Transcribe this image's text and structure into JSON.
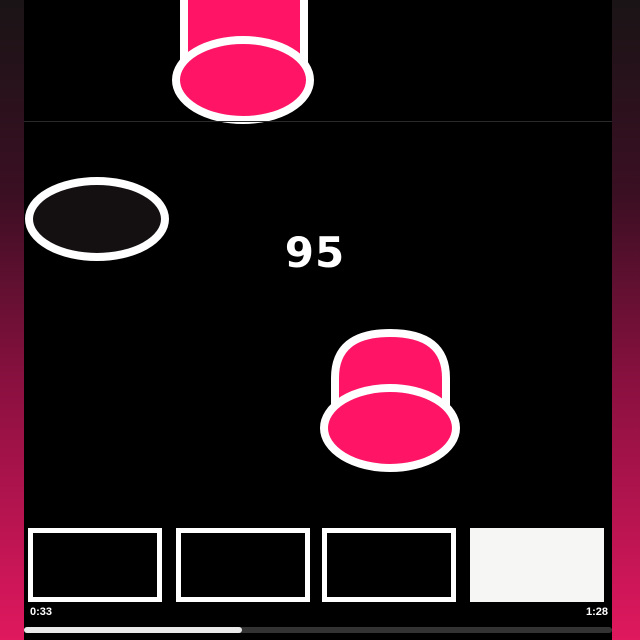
{
  "game": {
    "score": "95",
    "colors": {
      "piece": "#ff1466",
      "outline": "#ffffff",
      "hole": "#141012",
      "background": "#000000"
    }
  },
  "tiles": [
    {
      "state": "empty"
    },
    {
      "state": "empty"
    },
    {
      "state": "empty"
    },
    {
      "state": "filled"
    }
  ],
  "video": {
    "elapsed": "0:33",
    "duration": "1:28",
    "progress_fraction": 0.37
  }
}
